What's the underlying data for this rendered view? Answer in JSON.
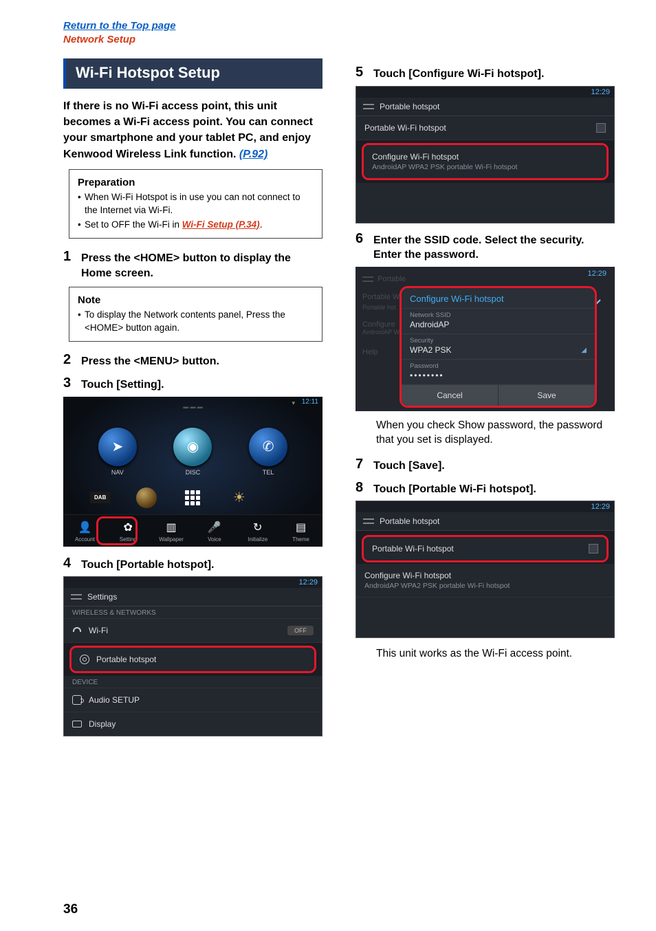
{
  "header": {
    "top_link": "Return to the Top page",
    "section_link": "Network Setup"
  },
  "section_title": "Wi-Fi Hotspot Setup",
  "intro": {
    "text_before": "If there is no Wi-Fi access point, this unit becomes a Wi-Fi access point. You can connect your smartphone and your tablet PC, and enjoy Kenwood Wireless Link function. ",
    "link": "(P.92)"
  },
  "preparation": {
    "title": "Preparation",
    "items": [
      {
        "text": "When Wi-Fi Hotspot is in use you can not connect to the Internet via Wi-Fi."
      },
      {
        "prefix": "Set to OFF the Wi-Fi in ",
        "link": "Wi-Fi Setup (P.34)",
        "suffix": "."
      }
    ]
  },
  "steps": {
    "s1": "Press the <HOME> button to display the Home screen.",
    "s2": "Press the <MENU> button.",
    "s3": "Touch [Setting].",
    "s4": "Touch [Portable hotspot].",
    "s5": "Touch [Configure Wi-Fi hotspot].",
    "s6": "Enter the SSID code. Select the security. Enter the password.",
    "s7": "Touch [Save].",
    "s8": "Touch [Portable Wi-Fi hotspot]."
  },
  "note": {
    "title": "Note",
    "text": "To display the Network contents panel, Press the <HOME> button again."
  },
  "followups": {
    "after6": "When you check Show password, the password that you set is displayed.",
    "after8": "This unit works as the Wi-Fi access point."
  },
  "screenshots": {
    "clock_1211": "12:11",
    "clock_1229": "12:29",
    "home": {
      "nav": "NAV",
      "disc": "DISC",
      "tel": "TEL",
      "dab": "DAB",
      "account": "Account",
      "setting": "Setting",
      "wallpaper": "Wallpaper",
      "voice": "Voice",
      "initialize": "Initialize",
      "theme": "Theme"
    },
    "settings": {
      "title": "Settings",
      "wireless": "WIRELESS & NETWORKS",
      "wifi": "Wi-Fi",
      "off": "OFF",
      "hotspot": "Portable hotspot",
      "device": "DEVICE",
      "audio": "Audio SETUP",
      "display": "Display"
    },
    "hotspot": {
      "title": "Portable hotspot",
      "row1": "Portable Wi-Fi hotspot",
      "row2": "Configure Wi-Fi hotspot",
      "row2sub": "AndroidAP WPA2 PSK portable Wi-Fi hotspot"
    },
    "dialog": {
      "bg_header": "Portable",
      "bg_row1a": "Portable W",
      "bg_row1b": "Portable hot",
      "bg_row2a": "Configure",
      "bg_row2b": "AndroidAP W",
      "bg_help": "Help",
      "title": "Configure Wi-Fi hotspot",
      "ssid_label": "Network SSID",
      "ssid_val": "AndroidAP",
      "sec_label": "Security",
      "sec_val": "WPA2 PSK",
      "pw_label": "Password",
      "pw_val": "••••••••",
      "cancel": "Cancel",
      "save": "Save"
    }
  },
  "page_number": "36"
}
